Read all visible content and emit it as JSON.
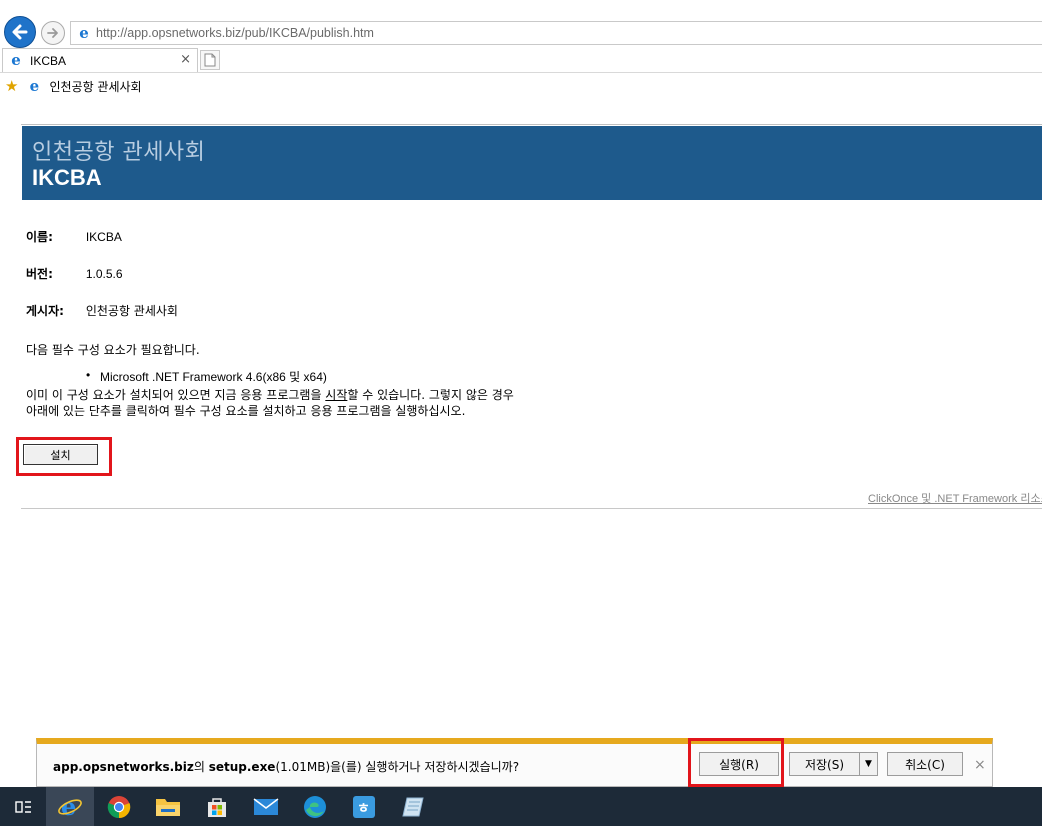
{
  "browser": {
    "url": "http://app.opsnetworks.biz/pub/IKCBA/publish.htm",
    "tab_title": "IKCBA",
    "tab_close": "×",
    "favorite_label": "인천공항 관세사회"
  },
  "page": {
    "banner_publisher": "인천공항 관세사회",
    "banner_title": "IKCBA",
    "name_label": "이름:",
    "name_value": "IKCBA",
    "version_label": "버전:",
    "version_value": "1.0.5.6",
    "publisher_label": "게시자:",
    "publisher_value": "인천공항 관세사회",
    "prereq_intro": "다음 필수 구성 요소가 필요합니다.",
    "prereq_item": "Microsoft .NET Framework 4.6(x86 및 x64)",
    "note_line1_before": "이미 이 구성 요소가 설치되어 있으면 지금 응용 프로그램을 ",
    "note_line1_link": "시작",
    "note_line1_after": "할 수 있습니다. 그렇지 않은 경우",
    "note_line2": "아래에 있는 단추를 클릭하여 필수 구성 요소를 설치하고 응용 프로그램을 실행하십시오.",
    "install_label": "설치",
    "resources_link": "ClickOnce 및 .NET Framework 리소스"
  },
  "download_bar": {
    "site": "app.opsnetworks.biz",
    "particle": "의 ",
    "file": "setup.exe",
    "size_text": "(1.01MB)을(를) 실행하거나 저장하시겠습니까?",
    "run_label": "실행(R)",
    "save_label": "저장(S)",
    "save_dropdown": "▼",
    "cancel_label": "취소(C)",
    "close_label": "×"
  },
  "taskbar": {
    "items": [
      "task-view",
      "internet-explorer",
      "chrome",
      "file-explorer",
      "store",
      "mail",
      "edge",
      "hancom-office",
      "app-notebook"
    ]
  },
  "colors": {
    "banner_bg": "#1e5a8c",
    "highlight": "#e2151b",
    "download_accent": "#e6a91e",
    "taskbar_bg": "#1d2a38"
  }
}
